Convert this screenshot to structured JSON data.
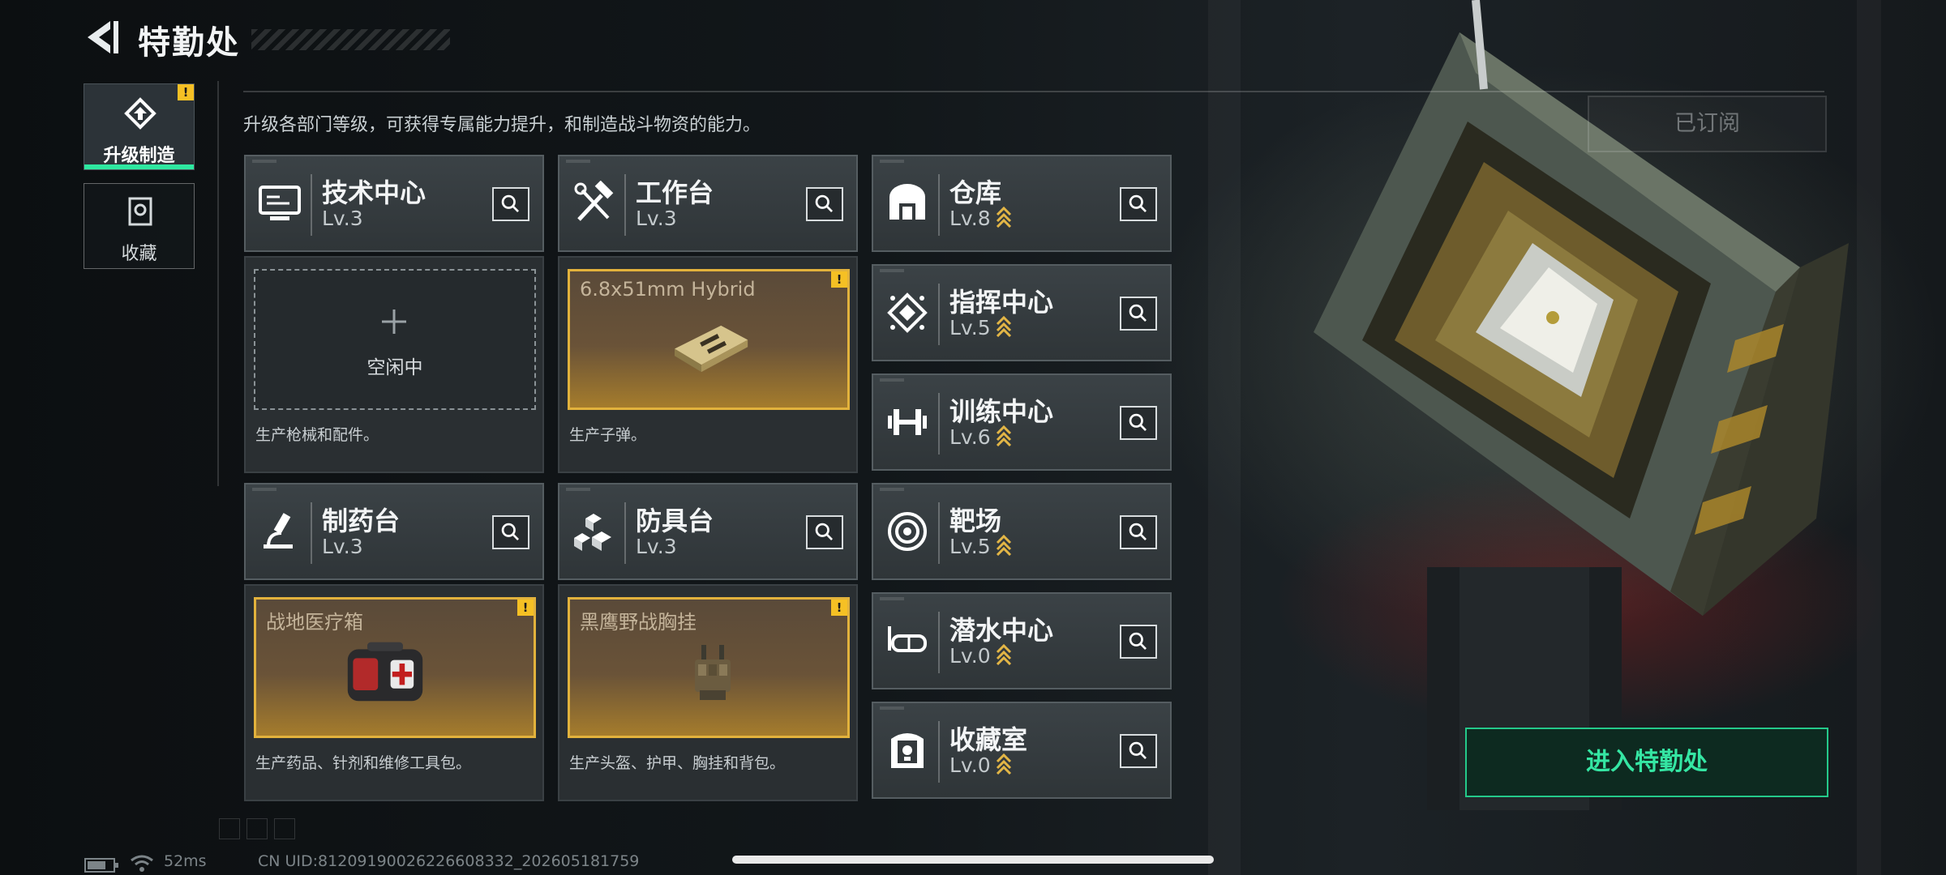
{
  "header": {
    "title": "特勤处"
  },
  "description": "升级各部门等级，可获得专属能力提升，和制造战斗物资的能力。",
  "tabs": [
    {
      "label": "升级制造",
      "active": true,
      "alert": "!"
    },
    {
      "label": "收藏",
      "active": false
    }
  ],
  "departments": {
    "tech": {
      "name": "技术中心",
      "level": "Lv.3",
      "icon": "monitor-icon"
    },
    "workbench": {
      "name": "工作台",
      "level": "Lv.3",
      "icon": "hammer-wrench-icon"
    },
    "pharmacy": {
      "name": "制药台",
      "level": "Lv.3",
      "icon": "microscope-icon"
    },
    "armor": {
      "name": "防具台",
      "level": "Lv.3",
      "icon": "blocks-icon"
    },
    "warehouse": {
      "name": "仓库",
      "level": "Lv.8",
      "icon": "warehouse-icon",
      "upgradable": true
    },
    "command": {
      "name": "指挥中心",
      "level": "Lv.5",
      "icon": "command-icon",
      "upgradable": true
    },
    "training": {
      "name": "训练中心",
      "level": "Lv.6",
      "icon": "dumbbell-icon",
      "upgradable": true
    },
    "range": {
      "name": "靶场",
      "level": "Lv.5",
      "icon": "target-icon",
      "upgradable": true
    },
    "diving": {
      "name": "潜水中心",
      "level": "Lv.0",
      "icon": "diving-mask-icon",
      "upgradable": true
    },
    "collection": {
      "name": "收藏室",
      "level": "Lv.0",
      "icon": "trophy-case-icon",
      "upgradable": true
    }
  },
  "production": {
    "tech": {
      "status": "空闲中",
      "desc": "生产枪械和配件。"
    },
    "workbench": {
      "item": "6.8x51mm Hybrid",
      "desc": "生产子弹。",
      "alert": "!"
    },
    "pharmacy": {
      "item": "战地医疗箱",
      "desc": "生产药品、针剂和维修工具包。",
      "alert": "!"
    },
    "armor": {
      "item": "黑鹰野战胸挂",
      "desc": "生产头盔、护甲、胸挂和背包。",
      "alert": "!"
    }
  },
  "right": {
    "subscribed_label": "已订阅",
    "enter_label": "进入特勤处"
  },
  "status_bar": {
    "ping": "52ms",
    "uid": "CN UID:81209190026226608332_202605181759"
  },
  "colors": {
    "accent": "#2ee8a0",
    "warn": "#f5c024",
    "gold_border": "#e2b23c"
  }
}
